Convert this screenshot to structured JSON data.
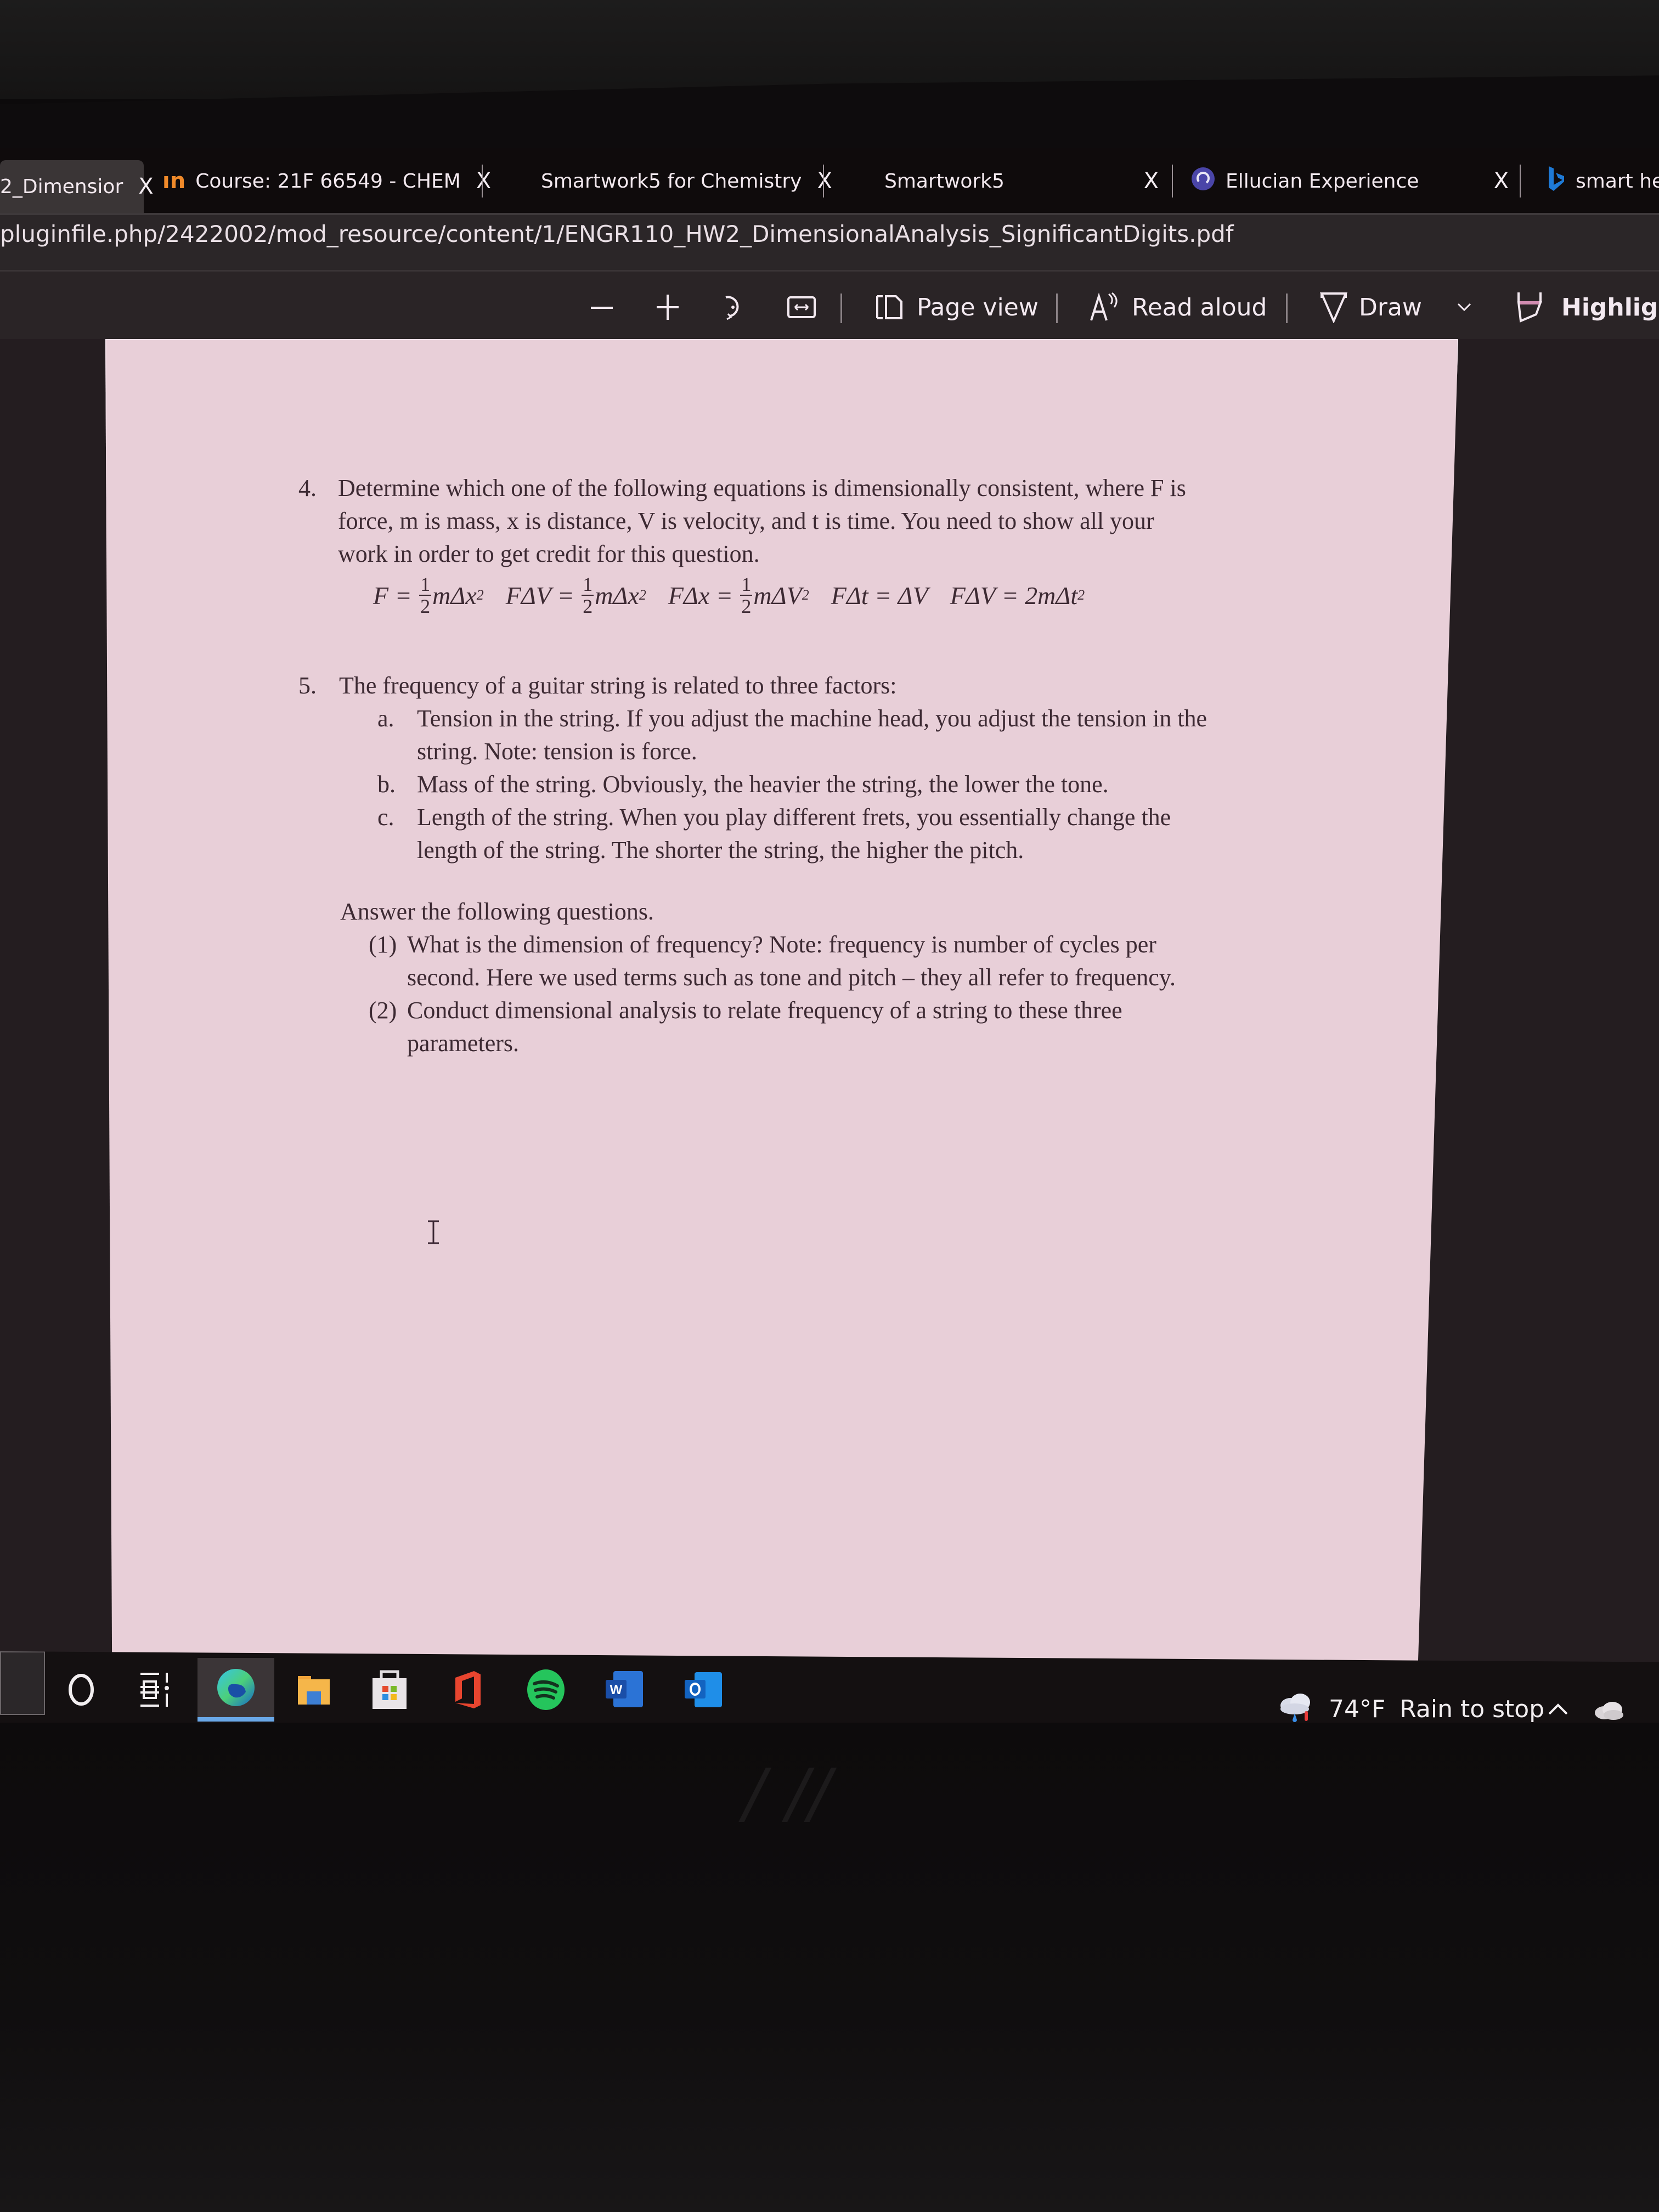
{
  "browser": {
    "tabs": [
      {
        "label": "2_Dimensior",
        "active": true,
        "closable": true,
        "favicon": "none"
      },
      {
        "label": "Course: 21F 66549 - CHEM",
        "active": false,
        "closable": true,
        "favicon": "moodle-icon"
      },
      {
        "label": "Smartwork5 for Chemistry",
        "active": false,
        "closable": true,
        "favicon": "none"
      },
      {
        "label": "Smartwork5",
        "active": false,
        "closable": true,
        "favicon": "none"
      },
      {
        "label": "Ellucian Experience",
        "active": false,
        "closable": true,
        "favicon": "ellucian-icon"
      },
      {
        "label": "smart he",
        "active": false,
        "closable": false,
        "favicon": "bing-icon"
      }
    ],
    "close_glyph": "X",
    "url": "pluginfile.php/2422002/mod_resource/content/1/ENGR110_HW2_DimensionalAnalysis_SignificantDigits.pdf"
  },
  "pdf_toolbar": {
    "zoom_out": "—",
    "zoom_in": "+",
    "rotate_icon": "rotate-icon",
    "fit_icon": "fit-width-icon",
    "page_view_label": "Page view",
    "read_aloud_label": "Read aloud",
    "draw_label": "Draw",
    "highlight_label": "Highlight"
  },
  "document": {
    "q4": {
      "number": "4.",
      "lines": [
        "Determine which one of the following equations is dimensionally consistent, where F is",
        "force, m is mass, x is distance, V is velocity, and t is time. You need to show all your",
        "work in order to get credit for this question."
      ],
      "equations": [
        {
          "lhs": "F",
          "frac": [
            "1",
            "2"
          ],
          "rhs": "mΔx",
          "exp": "2"
        },
        {
          "lhs": "FΔV",
          "frac": [
            "1",
            "2"
          ],
          "rhs": "mΔx",
          "exp": "2"
        },
        {
          "lhs": "FΔx",
          "frac": [
            "1",
            "2"
          ],
          "rhs": "mΔV",
          "exp": "2"
        },
        {
          "lhs": "FΔt",
          "frac": null,
          "rhs": "ΔV",
          "exp": ""
        },
        {
          "lhs": "FΔV",
          "frac": null,
          "rhs": "2mΔt",
          "exp": "2"
        }
      ]
    },
    "q5": {
      "number": "5.",
      "intro": "The frequency of a guitar string is related to three factors:",
      "items": [
        {
          "marker": "a.",
          "lines": [
            "Tension in the string. If you adjust the machine head, you adjust the tension in the",
            "string. Note: tension is force."
          ]
        },
        {
          "marker": "b.",
          "lines": [
            "Mass of the string. Obviously, the heavier the string, the lower the tone."
          ]
        },
        {
          "marker": "c.",
          "lines": [
            "Length of the string. When you play different frets, you essentially change the",
            "length of the string. The shorter the string, the higher the pitch."
          ]
        }
      ],
      "answer_intro": "Answer the following questions.",
      "questions": [
        {
          "marker": "(1)",
          "lines": [
            "What is the dimension of frequency? Note: frequency is number of cycles per",
            "second.  Here we used terms such as tone and pitch – they all refer to frequency."
          ]
        },
        {
          "marker": "(2)",
          "lines": [
            "Conduct dimensional analysis to relate frequency of a string to these three",
            "parameters."
          ]
        }
      ]
    }
  },
  "taskbar": {
    "apps": [
      "search-icon",
      "task-view-icon",
      "edge-icon",
      "file-explorer-icon",
      "store-icon",
      "office-icon",
      "spotify-icon",
      "word-icon",
      "outlook-icon"
    ],
    "active_app": "edge-icon",
    "weather_temp": "74°F",
    "weather_text": "Rain to stop",
    "tray_chevron": "^"
  },
  "colors": {
    "page_bg": "#e8cfd8",
    "text": "#3d2a33",
    "toolbar_bg": "#2a2426",
    "tab_bg": "#0f0b0c",
    "edge_active_underline": "#6aa8e8"
  }
}
